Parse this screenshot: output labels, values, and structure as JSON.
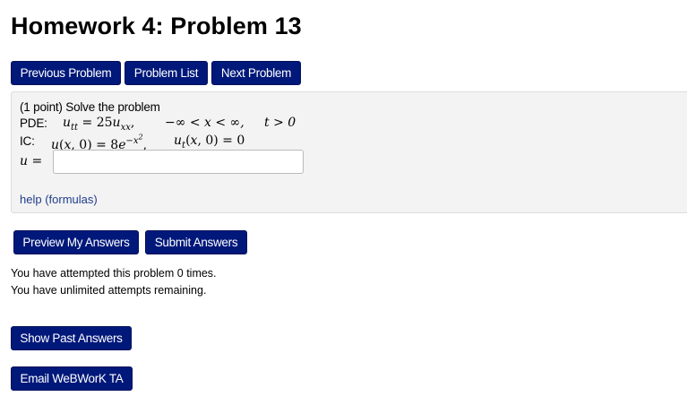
{
  "page": {
    "title": "Homework 4: Problem 13"
  },
  "nav": {
    "previous_label": "Previous Problem",
    "list_label": "Problem List",
    "next_label": "Next Problem"
  },
  "problem": {
    "points": "(1 point) Solve the problem",
    "pde_label": "PDE:",
    "pde_equation": "u_tt = 25u_xx,",
    "pde_domain": "−∞ < x < ∞,",
    "pde_time": "t > 0",
    "ic_label": "IC:",
    "ic_first": "u(x, 0) = 8e^(−x²),",
    "ic_second": "u_t(x, 0) = 0",
    "answer_label": "u =",
    "answer_value": "",
    "help_link": "help (formulas)"
  },
  "actions": {
    "preview_label": "Preview My Answers",
    "submit_label": "Submit Answers"
  },
  "status": {
    "attempts": "You have attempted this problem 0 times.",
    "remaining": "You have unlimited attempts remaining."
  },
  "extra": {
    "past_answers_label": "Show Past Answers",
    "email_ta_label": "Email WeBWorK TA"
  },
  "colors": {
    "button_bg": "#00187a",
    "problem_bg": "#f3f3f3",
    "link": "#1f3d8a"
  }
}
